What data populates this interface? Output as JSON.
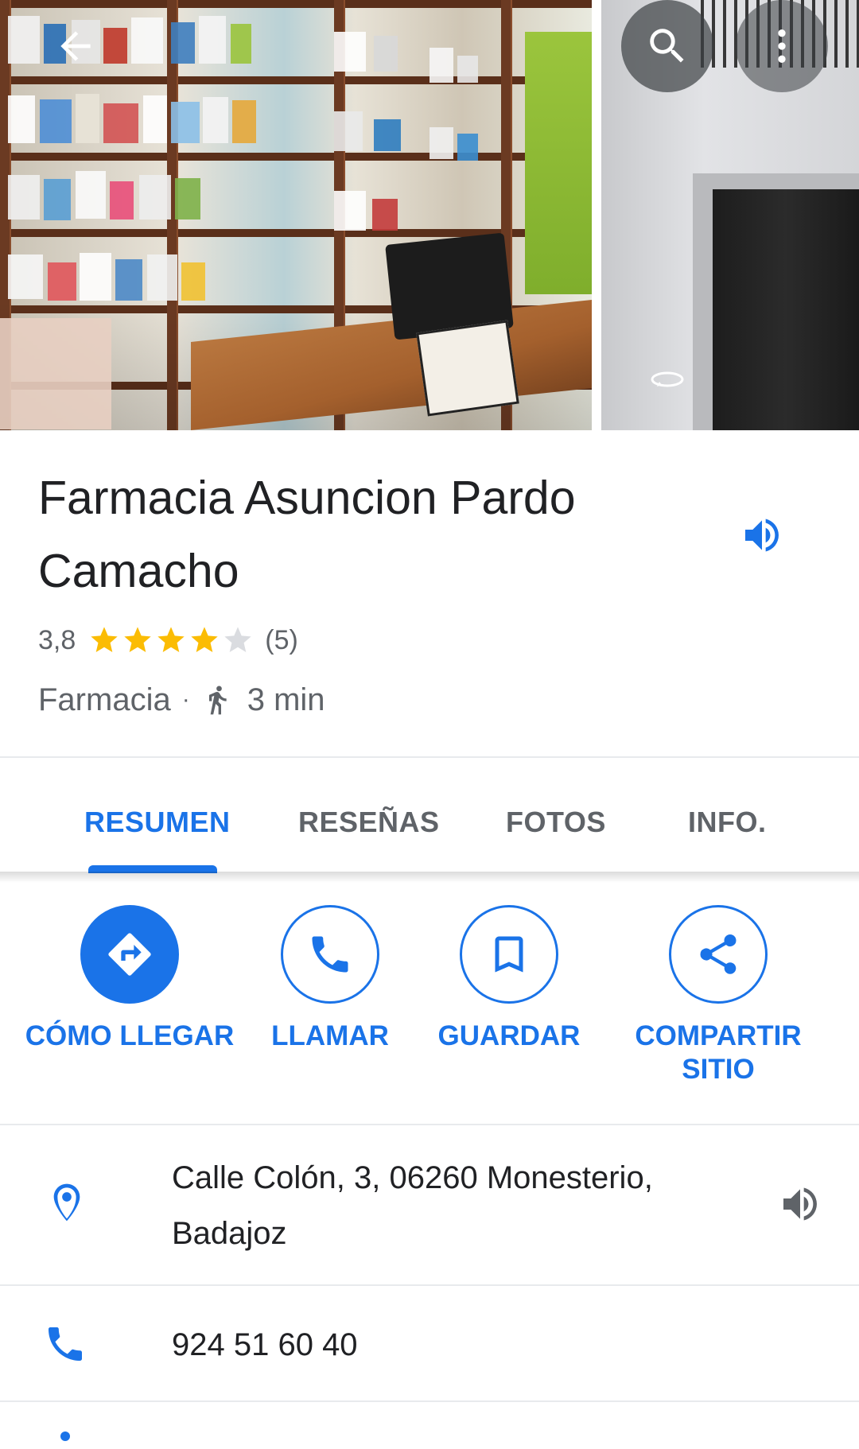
{
  "header": {
    "back_icon": "arrow-left-icon",
    "search_icon": "search-icon",
    "more_icon": "more-vert-icon"
  },
  "place": {
    "name": "Farmacia Asuncion Pardo Camacho",
    "rating": "3,8",
    "stars": 3.8,
    "review_count": "(5)",
    "category": "Farmacia",
    "separator": "·",
    "walk_time": "3 min"
  },
  "tabs": [
    {
      "label": "RESUMEN",
      "active": true
    },
    {
      "label": "RESEÑAS",
      "active": false
    },
    {
      "label": "FOTOS",
      "active": false
    },
    {
      "label": "INFO.",
      "active": false
    }
  ],
  "actions": [
    {
      "label": "CÓMO LLEGAR",
      "icon": "directions-icon"
    },
    {
      "label": "LLAMAR",
      "icon": "phone-icon"
    },
    {
      "label": "GUARDAR",
      "icon": "bookmark-icon"
    },
    {
      "label": "COMPARTIR SITIO",
      "icon": "share-icon"
    }
  ],
  "info": {
    "address": "Calle Colón, 3, 06260 Monesterio, Badajoz",
    "phone": "924 51 60 40"
  },
  "colors": {
    "accent": "#1a73e8",
    "star": "#fbbc04",
    "text_secondary": "#5f6368"
  }
}
